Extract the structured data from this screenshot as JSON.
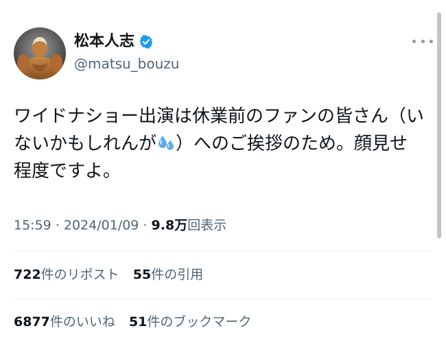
{
  "author": {
    "display_name": "松本人志",
    "handle": "@matsu_bouzu",
    "avatar_icon": "avatar-muscle-figure",
    "verified_icon": "verified-badge-icon"
  },
  "tweet": {
    "text_part1": "ワイドナショー出演は休業前のファンの皆さん（いないかもしれんが",
    "emoji_icon": "sweat-droplets-icon",
    "text_part2": "）へのご挨拶のため。顔見せ程度ですよ。"
  },
  "meta": {
    "time": "15:59",
    "separator1": " · ",
    "date": "2024/01/09",
    "separator2": " · ",
    "views_value": "9.8万",
    "views_label": "回表示"
  },
  "stats": {
    "reposts_value": "722",
    "reposts_label": "件のリポスト",
    "quotes_value": "55",
    "quotes_label": "件の引用",
    "likes_value": "6877",
    "likes_label": "件のいいね",
    "bookmarks_value": "51",
    "bookmarks_label": "件のブックマーク"
  },
  "colors": {
    "text_primary": "#0f1419",
    "text_secondary": "#536471",
    "verified_blue": "#1d9bf0",
    "divider": "#eff3f4"
  }
}
